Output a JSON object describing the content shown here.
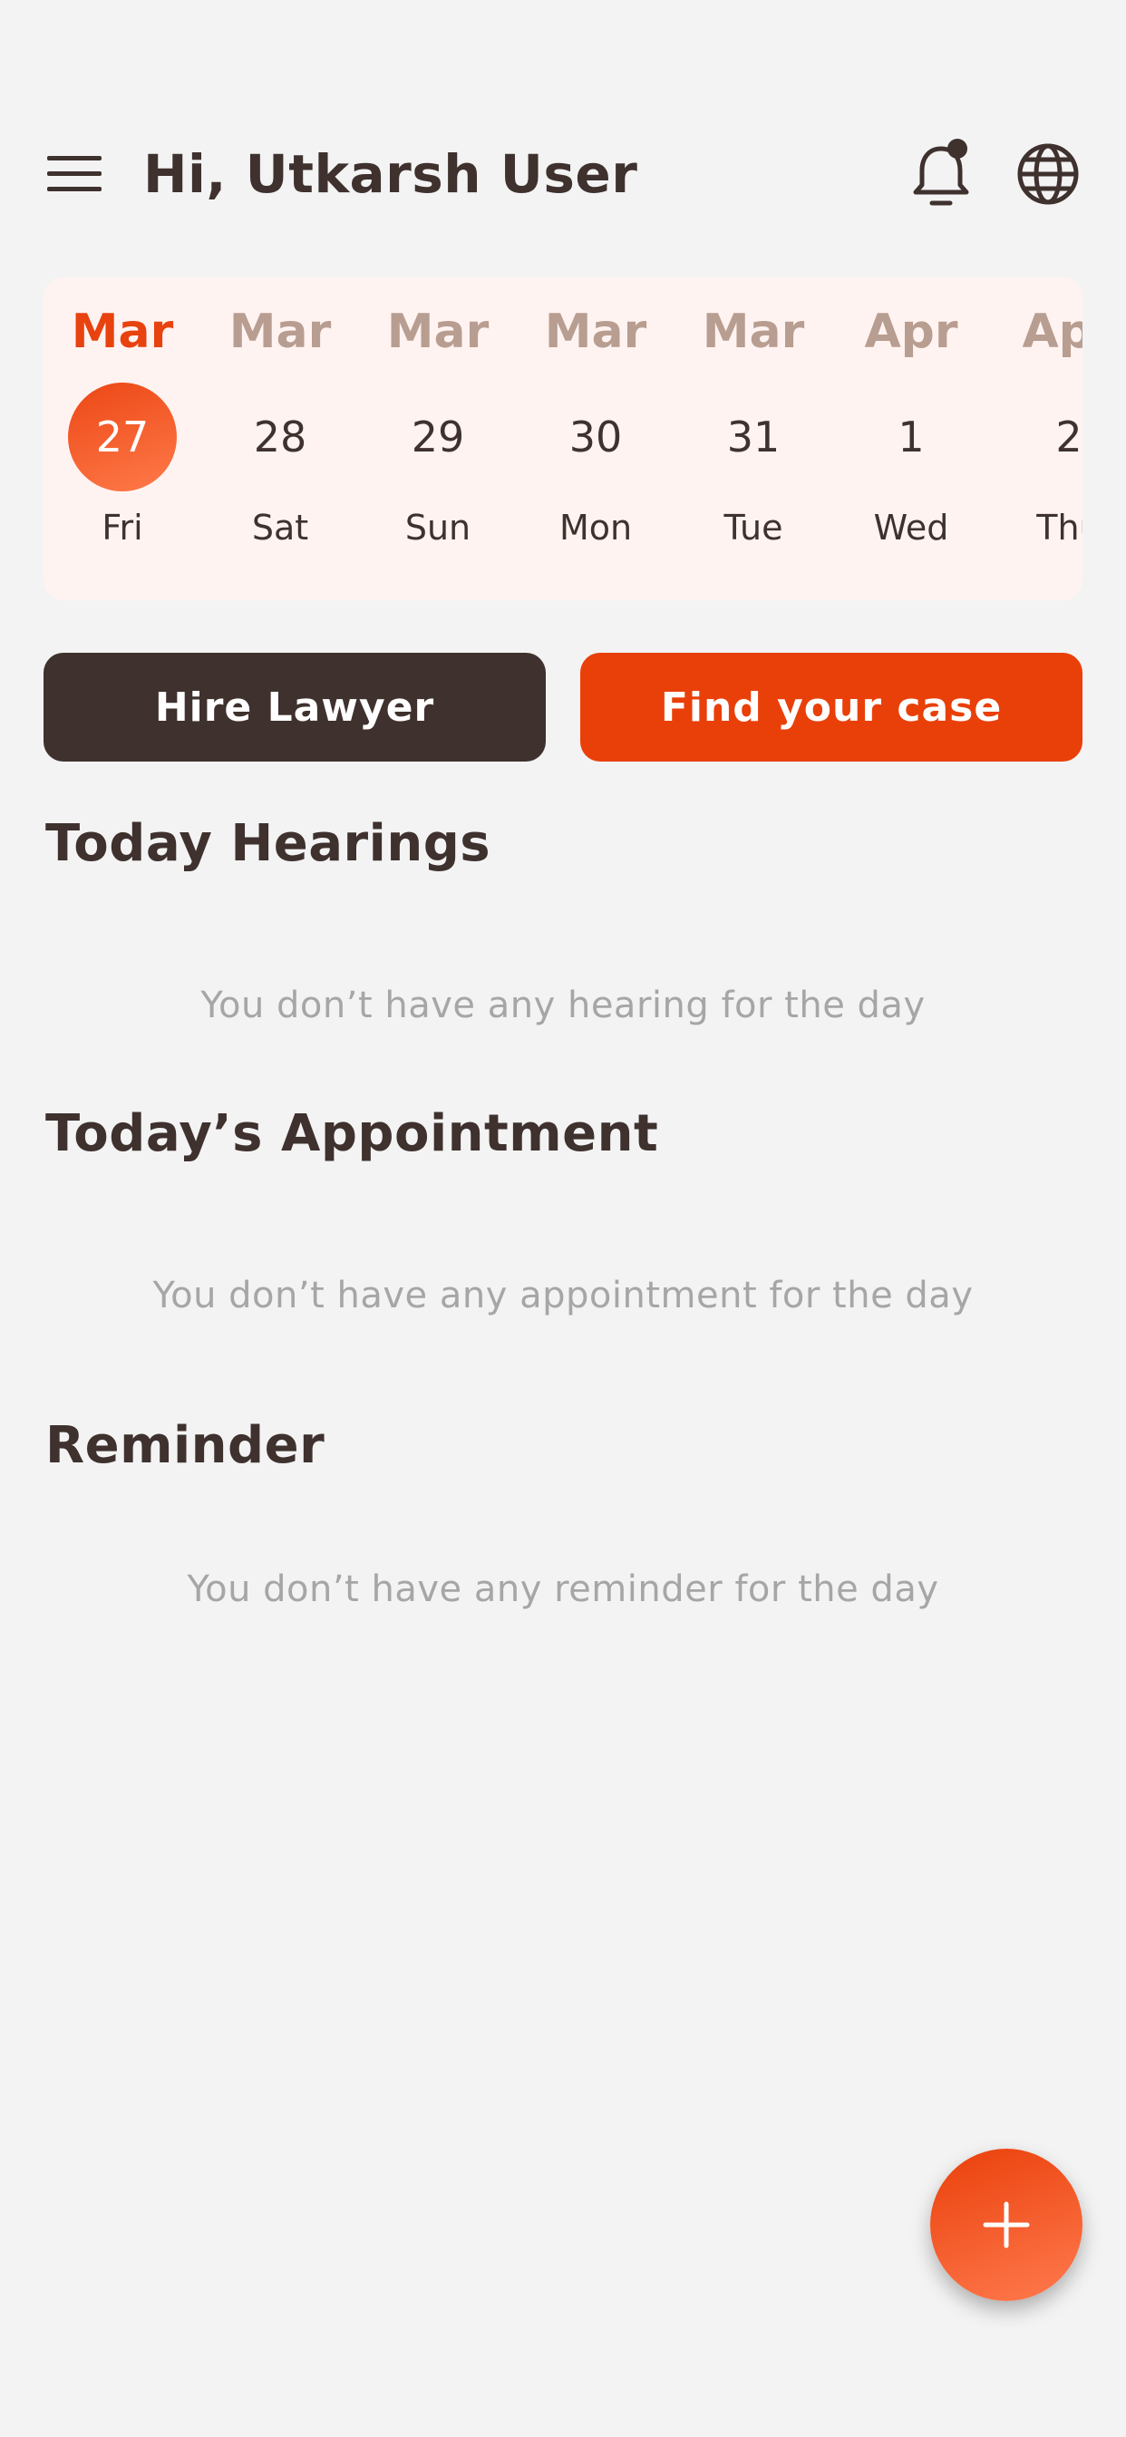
{
  "header": {
    "greeting": "Hi, Utkarsh User",
    "menu_icon": "hamburger-menu-icon",
    "notification_icon": "bell-icon",
    "language_icon": "globe-icon",
    "notification_dot": true
  },
  "calendar": {
    "selected_index": 0,
    "days": [
      {
        "month": "Mar",
        "date": "27",
        "weekday": "Fri"
      },
      {
        "month": "Mar",
        "date": "28",
        "weekday": "Sat"
      },
      {
        "month": "Mar",
        "date": "29",
        "weekday": "Sun"
      },
      {
        "month": "Mar",
        "date": "30",
        "weekday": "Mon"
      },
      {
        "month": "Mar",
        "date": "31",
        "weekday": "Tue"
      },
      {
        "month": "Apr",
        "date": "1",
        "weekday": "Wed"
      },
      {
        "month": "Apr",
        "date": "2",
        "weekday": "Thu"
      }
    ]
  },
  "actions": {
    "hire_label": "Hire Lawyer",
    "find_label": "Find your case"
  },
  "sections": {
    "hearings": {
      "title": "Today Hearings",
      "empty": "You don’t have any hearing for the day"
    },
    "appointment": {
      "title": "Today’s Appointment",
      "empty": "You don’t have any appointment for the day"
    },
    "reminder": {
      "title": "Reminder",
      "empty": "You don’t have any reminder for the day"
    }
  },
  "fab": {
    "icon": "plus-icon"
  },
  "colors": {
    "accent": "#e9400a",
    "dark": "#3e312e",
    "background": "#f3f3f3",
    "calendar_bg": "#fff3f1",
    "muted_month": "#b89d91",
    "empty_text": "#a6a6a6"
  }
}
